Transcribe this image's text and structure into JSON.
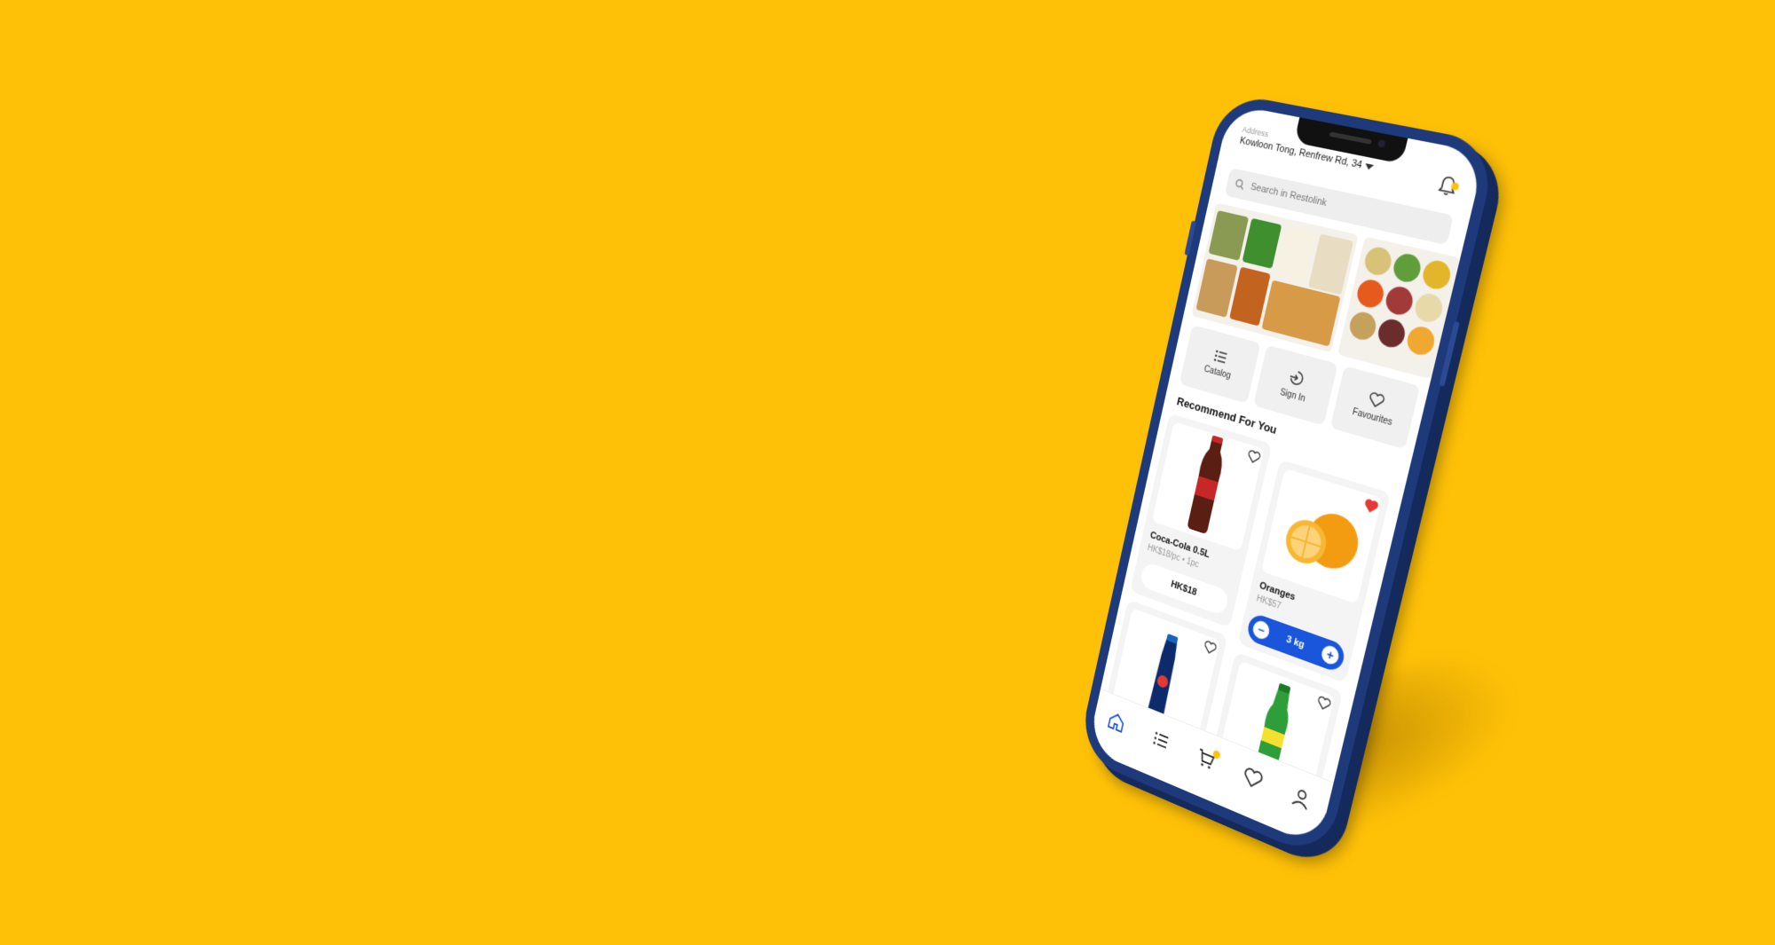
{
  "colors": {
    "background": "#FFC107",
    "phone_frame": "#1f3a7a",
    "accent_blue": "#1a56db",
    "badge_yellow": "#FFC107",
    "fav_red": "#e53935"
  },
  "header": {
    "address_label": "Address",
    "address": "Kowloon Tong, Renfrew Rd, 34"
  },
  "search": {
    "placeholder": "Search in Restolink"
  },
  "quick_actions": [
    {
      "label": "Catalog",
      "icon": "list-icon"
    },
    {
      "label": "Sign In",
      "icon": "sign-in-icon"
    },
    {
      "label": "Favourites",
      "icon": "heart-icon"
    }
  ],
  "section": {
    "title": "Recommend For You"
  },
  "products": [
    {
      "name": "Coca-Cola 0.5L",
      "sub": "HK$18/pc • 1pc",
      "price": "HK$18",
      "favourite": false
    },
    {
      "name": "Oranges",
      "sub": "HK$57",
      "quantity": "3 kg",
      "favourite": true
    },
    {
      "name": "",
      "favourite": false
    },
    {
      "name": "",
      "favourite": false
    }
  ],
  "tabbar": [
    {
      "icon": "home-icon",
      "active": true
    },
    {
      "icon": "catalog-icon",
      "active": false
    },
    {
      "icon": "cart-icon",
      "active": false
    },
    {
      "icon": "heart-icon",
      "active": false
    },
    {
      "icon": "profile-icon",
      "active": false
    }
  ]
}
